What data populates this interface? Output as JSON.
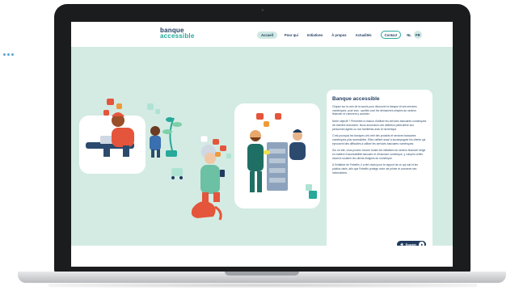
{
  "site": {
    "logo_top": "banque",
    "logo_bottom": "accessible",
    "nav": [
      {
        "label": "Accueil",
        "active": true
      },
      {
        "label": "Pour qui",
        "active": false
      },
      {
        "label": "Initiatives",
        "active": false
      },
      {
        "label": "À propos",
        "active": false
      },
      {
        "label": "Actualités",
        "active": false
      }
    ],
    "contact_label": "Contact",
    "lang_nl": "NL",
    "lang_fr": "FR"
  },
  "card": {
    "title": "Banque accessible",
    "paragraphs": [
      "Cliquez sur la voix de la souris pour découvrir la banque et ses services numériques, pour tous : quelles sont les démarches simples au secteur financier et comment y accéder.",
      "Notre objectif ? Permettre à chacun d'utiliser les services bancaires numériques de manière autonome. Nous accordons une attention particulière aux personnes âgées ou non familières avec le numérique.",
      "C'est pourquoi les banques ont créé des produits et services bancaires numériques plus accessibles. Elles veillent aussi à accompagner les clients qui éprouvent des difficultés à utiliser les services bancaires numériques.",
      "Sur ce site, vous pouvez trouver toutes les initiatives du secteur financier belge en matière d'accessibilité bancaire et d'inclusion numérique, y compris celles visant à soutenir les clients éloignés du numérique.",
      "À l'initiative de Febelfin, il a été choisi pour le rapport de ce qui suit et les publics visés, afin que Febelfin protège votre vie privée et conserve ses informations."
    ],
    "listen_label": "Écouter"
  },
  "colors": {
    "hero_bg": "#d3ebe3",
    "navy": "#1f3a5f",
    "teal": "#27a89a",
    "speech_red": "#e4553b",
    "speech_orange": "#f0993a"
  },
  "icons": [
    "speaker-icon",
    "play-icon",
    "camera-dot-icon"
  ]
}
